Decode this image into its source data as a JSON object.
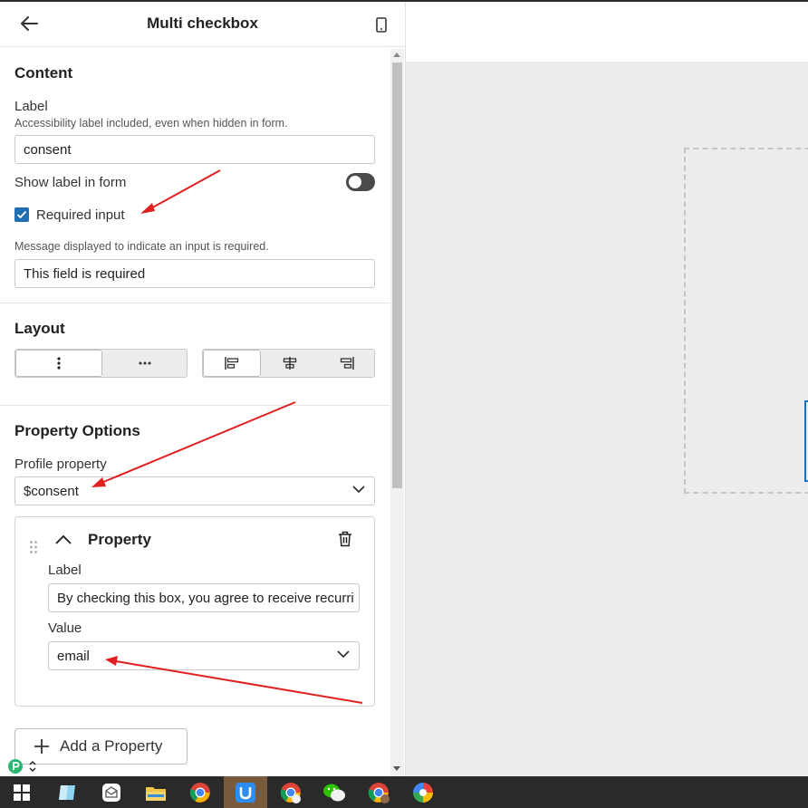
{
  "header": {
    "title": "Multi checkbox"
  },
  "content": {
    "section_title": "Content",
    "label_title": "Label",
    "label_help": "Accessibility label included, even when hidden in form.",
    "label_value": "consent",
    "show_label_text": "Show label in form",
    "show_label_on": false,
    "required_text": "Required input",
    "required_checked": true,
    "required_message_help": "Message displayed to indicate an input is required.",
    "required_message_value": "This field is required"
  },
  "layout": {
    "section_title": "Layout",
    "orientation_options": [
      "vertical",
      "horizontal"
    ],
    "orientation_selected": "vertical",
    "align_options": [
      "left",
      "center",
      "right"
    ],
    "align_selected": "left"
  },
  "property_options": {
    "section_title": "Property Options",
    "profile_property_label": "Profile property",
    "profile_property_value": "$consent",
    "property_card": {
      "title": "Property",
      "label_title": "Label",
      "label_value": "By checking this box, you agree to receive recurri",
      "value_title": "Value",
      "value_selected": "email"
    },
    "add_button_label": "Add a Property"
  },
  "colors": {
    "accent": "#1f6fb2",
    "annotation": "#e02020",
    "canvas": "#ececed",
    "taskbar": "#2a2a2a"
  },
  "taskbar": {
    "icons": [
      "windows-start-icon",
      "app-icon",
      "mail-icon",
      "file-explorer-icon",
      "chrome-icon",
      "app-u-icon",
      "chrome-icon",
      "wechat-icon",
      "chrome-icon",
      "color-app-icon"
    ]
  }
}
